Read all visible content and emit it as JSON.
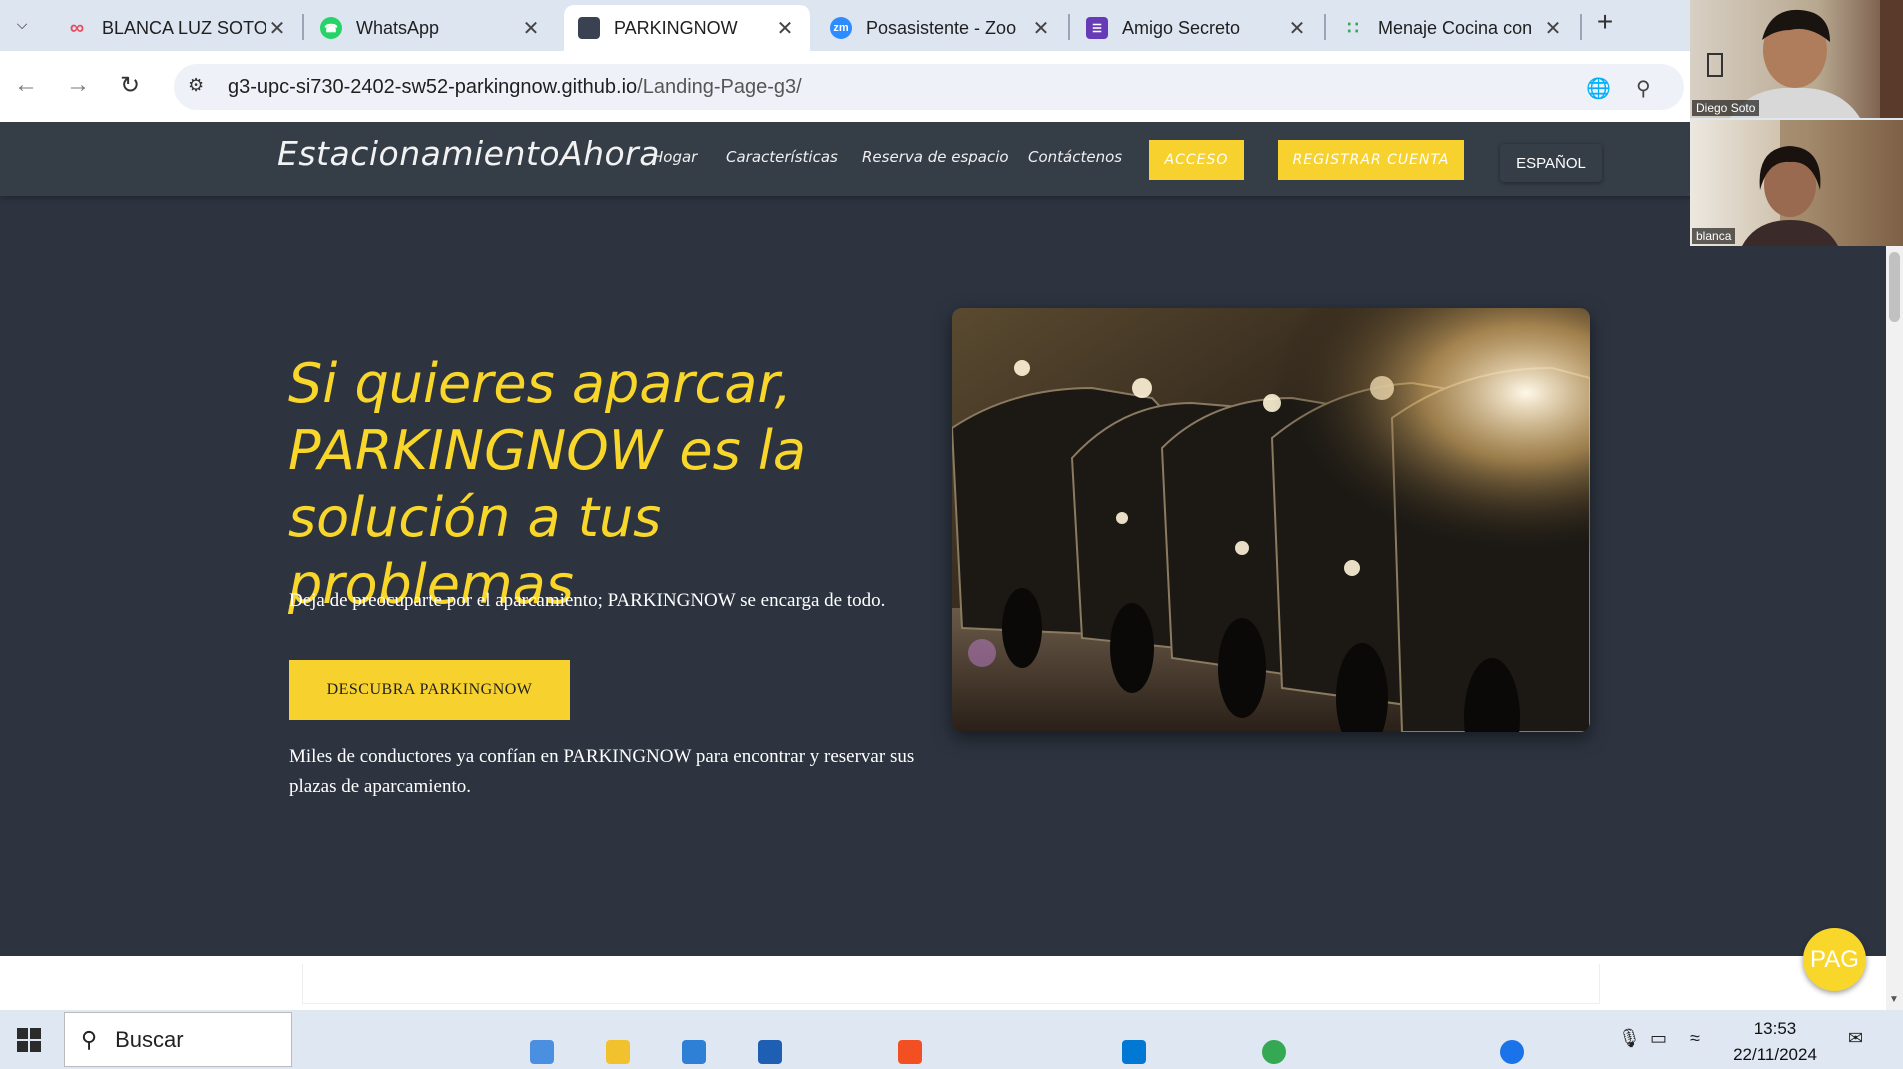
{
  "browser": {
    "tabs": [
      {
        "title": "BLANCA LUZ SOTO",
        "icon": "blanca-favicon",
        "color": "#e84a5f",
        "active": false
      },
      {
        "title": "WhatsApp",
        "icon": "whatsapp-icon",
        "color": "#25d366",
        "active": false
      },
      {
        "title": "PARKINGNOW",
        "icon": "parkingnow-favicon",
        "color": "#3a4150",
        "active": true
      },
      {
        "title": "Posasistente - Zoo",
        "icon": "zoom-icon",
        "color": "#2d8cff",
        "active": false
      },
      {
        "title": "Amigo Secreto",
        "icon": "forms-icon",
        "color": "#673ab7",
        "active": false
      },
      {
        "title": "Menaje Cocina con",
        "icon": "dots-icon",
        "color": "#34a853",
        "active": false
      }
    ],
    "url_host": "g3-upc-si730-2402-sw52-parkingnow.github.io",
    "url_path": "/Landing-Page-g3/"
  },
  "site": {
    "brand": "EstacionamientoAhora",
    "nav": [
      "Hogar",
      "Características",
      "Reserva de espacio",
      "Contáctenos"
    ],
    "login": "ACCESO",
    "register": "REGISTRAR CUENTA",
    "language": "ESPAÑOL",
    "hero_title": "Si quieres aparcar, PARKINGNOW es la solución a tus problemas",
    "hero_subtitle": "Deja de preocuparte por el aparcamiento; PARKINGNOW se encarga de todo.",
    "cta": "DESCUBRA PARKINGNOW",
    "hero_note": "Miles de conductores ya confían en PARKINGNOW para encontrar y reservar sus plazas de aparcamiento.",
    "fab": "PAG",
    "accent": "#f7d22e"
  },
  "video": {
    "participant1": "Diego Soto",
    "participant2": "blanca"
  },
  "taskbar": {
    "search": "Buscar",
    "time": "13:53",
    "date": "22/11/2024"
  }
}
